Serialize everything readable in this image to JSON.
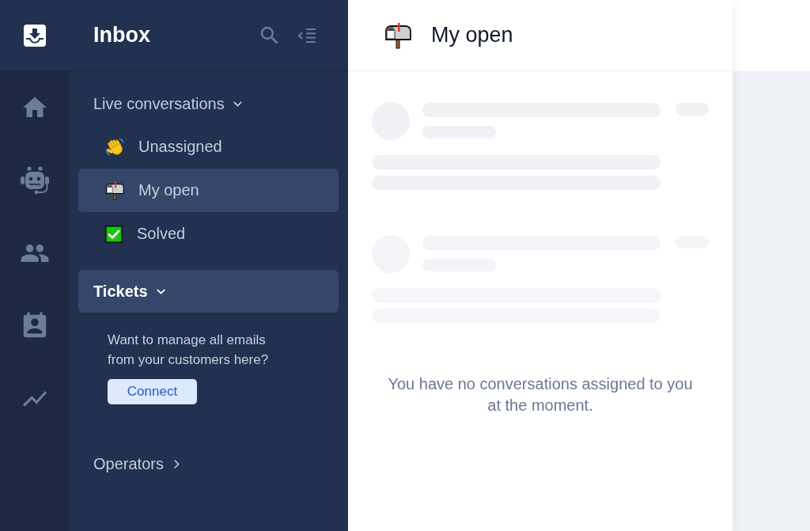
{
  "rail": [
    {
      "selected": true
    },
    {
      "selected": false
    },
    {
      "selected": false
    },
    {
      "selected": false
    },
    {
      "selected": false
    },
    {
      "selected": false
    }
  ],
  "sidebar": {
    "title": "Inbox",
    "sections": [
      {
        "label": "Live conversations",
        "expanded": true,
        "highlighted": false,
        "items": [
          {
            "label": "Unassigned",
            "selected": false
          },
          {
            "label": "My open",
            "selected": true
          },
          {
            "label": "Solved",
            "selected": false
          }
        ]
      },
      {
        "label": "Tickets",
        "expanded": true,
        "highlighted": true,
        "message": "Want to manage all emails from your customers here?",
        "button": "Connect"
      },
      {
        "label": "Operators",
        "expanded": false,
        "highlighted": false
      }
    ]
  },
  "main": {
    "title": "My open",
    "empty_message": "You have no conversations assigned to you at the moment."
  }
}
